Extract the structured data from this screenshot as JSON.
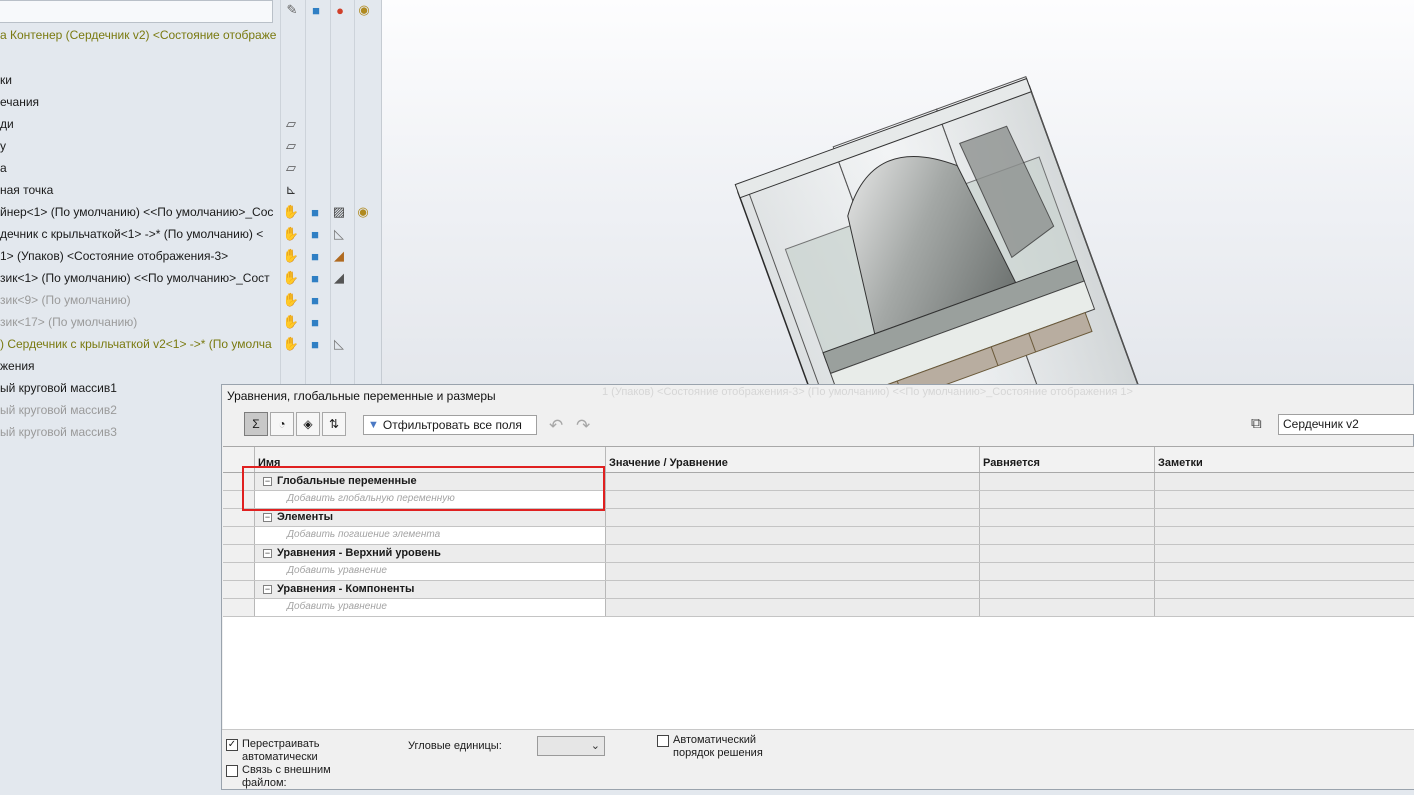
{
  "tree": {
    "root_label": "а Контенер (Сердечник v2) <Состояние отображе",
    "items": [
      {
        "label": "ки",
        "style": "normal"
      },
      {
        "label": "ечания",
        "style": "normal"
      },
      {
        "label": "ди",
        "style": "normal"
      },
      {
        "label": "у",
        "style": "normal"
      },
      {
        "label": "а",
        "style": "normal"
      },
      {
        "label": "ная точка",
        "style": "normal"
      },
      {
        "label": "йнер<1> (По умолчанию) <<По умолчанию>_Сос",
        "style": "normal"
      },
      {
        "label": "дечник с крыльчаткой<1> ->* (По умолчанию) <",
        "style": "normal"
      },
      {
        "label": "1> (Упаков) <Состояние отображения-3>",
        "style": "normal"
      },
      {
        "label": "зик<1> (По умолчанию) <<По умолчанию>_Сост",
        "style": "normal"
      },
      {
        "label": "зик<9> (По умолчанию)",
        "style": "gray"
      },
      {
        "label": "зик<17> (По умолчанию)",
        "style": "gray"
      },
      {
        "label": ") Сердечник с крыльчаткой v2<1> ->* (По умолча",
        "style": "yellow"
      },
      {
        "label": "жения",
        "style": "normal"
      },
      {
        "label": "ый круговой массив1",
        "style": "normal"
      },
      {
        "label": "ый круговой массив2",
        "style": "gray"
      },
      {
        "label": "ый круговой массив3",
        "style": "gray"
      }
    ],
    "header_icons": [
      "pencil-slash-icon",
      "cube-icon",
      "appearance-ball-icon",
      "eye-icon"
    ]
  },
  "dialog": {
    "title": "Уравнения, глобальные переменные и размеры",
    "ghost_text": "1 (Упаков) <Состояние отображения-3> (По умолчанию) <<По умолчанию>_Состояние отображения 1>",
    "filter_placeholder": "Отфильтровать все поля",
    "document_select": "Сердечник v2",
    "columns": [
      "Имя",
      "Значение / Уравнение",
      "Равняется",
      "Заметки"
    ],
    "groups": [
      {
        "toggle": "−",
        "label": "Глобальные переменные",
        "add_label": "Добавить глобальную переменную"
      },
      {
        "toggle": "−",
        "label": "Элементы",
        "add_label": "Добавить погашение элемента"
      },
      {
        "toggle": "−",
        "label": "Уравнения - Верхний уровень",
        "add_label": "Добавить уравнение"
      },
      {
        "toggle": "−",
        "label": "Уравнения - Компоненты",
        "add_label": "Добавить уравнение"
      }
    ],
    "bottom": {
      "rebuild_label": "Перестраивать автоматически",
      "rebuild_checked": true,
      "external_label": "Связь с внешним файлом:",
      "external_checked": false,
      "angle_units_label": "Угловые единицы:",
      "angle_units_value": "",
      "auto_order_label": "Автоматический порядок решения",
      "auto_order_checked": false
    },
    "toolbar_buttons": [
      "equations-view-icon",
      "sketch-equations-view-icon",
      "dimensions-view-icon",
      "ordered-view-icon"
    ]
  },
  "colors": {
    "highlight": "#e02020",
    "tree_yellow": "#7a7a10",
    "tree_gray": "#9a9a9a",
    "panel_bg": "#e3e8ee"
  }
}
